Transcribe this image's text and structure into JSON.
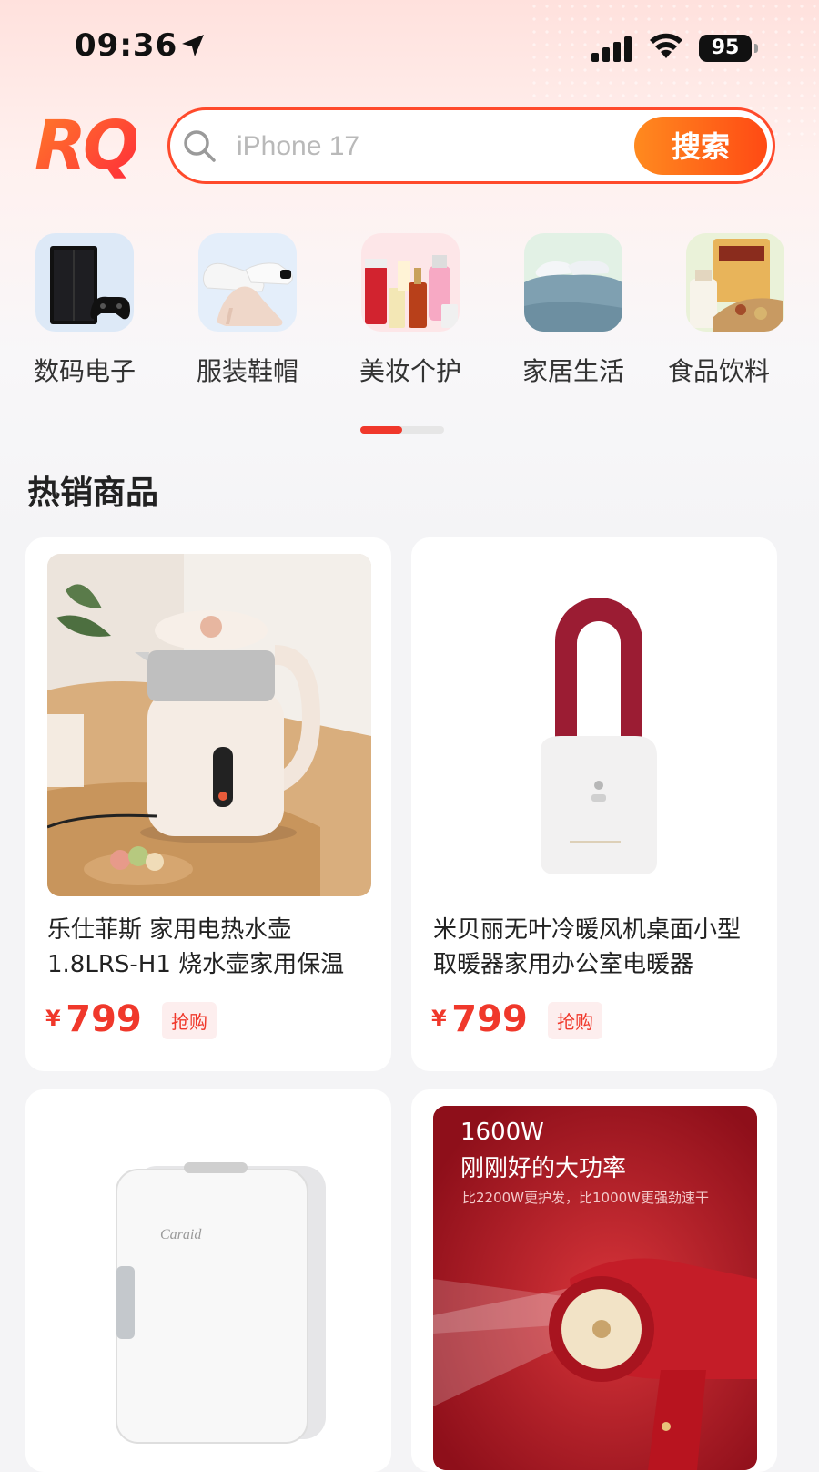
{
  "status": {
    "time": "09:36",
    "battery": "95"
  },
  "brand": {
    "logo": "RQ"
  },
  "search": {
    "placeholder": "iPhone 17",
    "button": "搜索"
  },
  "categories": [
    {
      "label": "数码电子",
      "icon": "game-console-icon"
    },
    {
      "label": "服装鞋帽",
      "icon": "shoes-icon"
    },
    {
      "label": "美妆个护",
      "icon": "cosmetics-icon"
    },
    {
      "label": "家居生活",
      "icon": "bedding-icon"
    },
    {
      "label": "食品饮料",
      "icon": "food-icon"
    }
  ],
  "section": {
    "title": "热销商品"
  },
  "products": [
    {
      "title": "乐仕菲斯 家用电热水壶1.8LRS-H1 烧水壶家用保温",
      "currency": "¥",
      "price": "799",
      "tag": "抢购"
    },
    {
      "title": "米贝丽无叶冷暖风机桌面小型取暖器家用办公室电暖器",
      "currency": "¥",
      "price": "799",
      "tag": "抢购"
    },
    {
      "title": "",
      "brand_mark": "Caraid"
    },
    {
      "title": "",
      "banner_line1": "1600W",
      "banner_line2": "刚刚好的大功率",
      "banner_line3": "比2200W更护发，比1000W更强劲速干"
    }
  ],
  "colors": {
    "accent": "#f0382b",
    "search_btn": "#ff6a1a"
  }
}
